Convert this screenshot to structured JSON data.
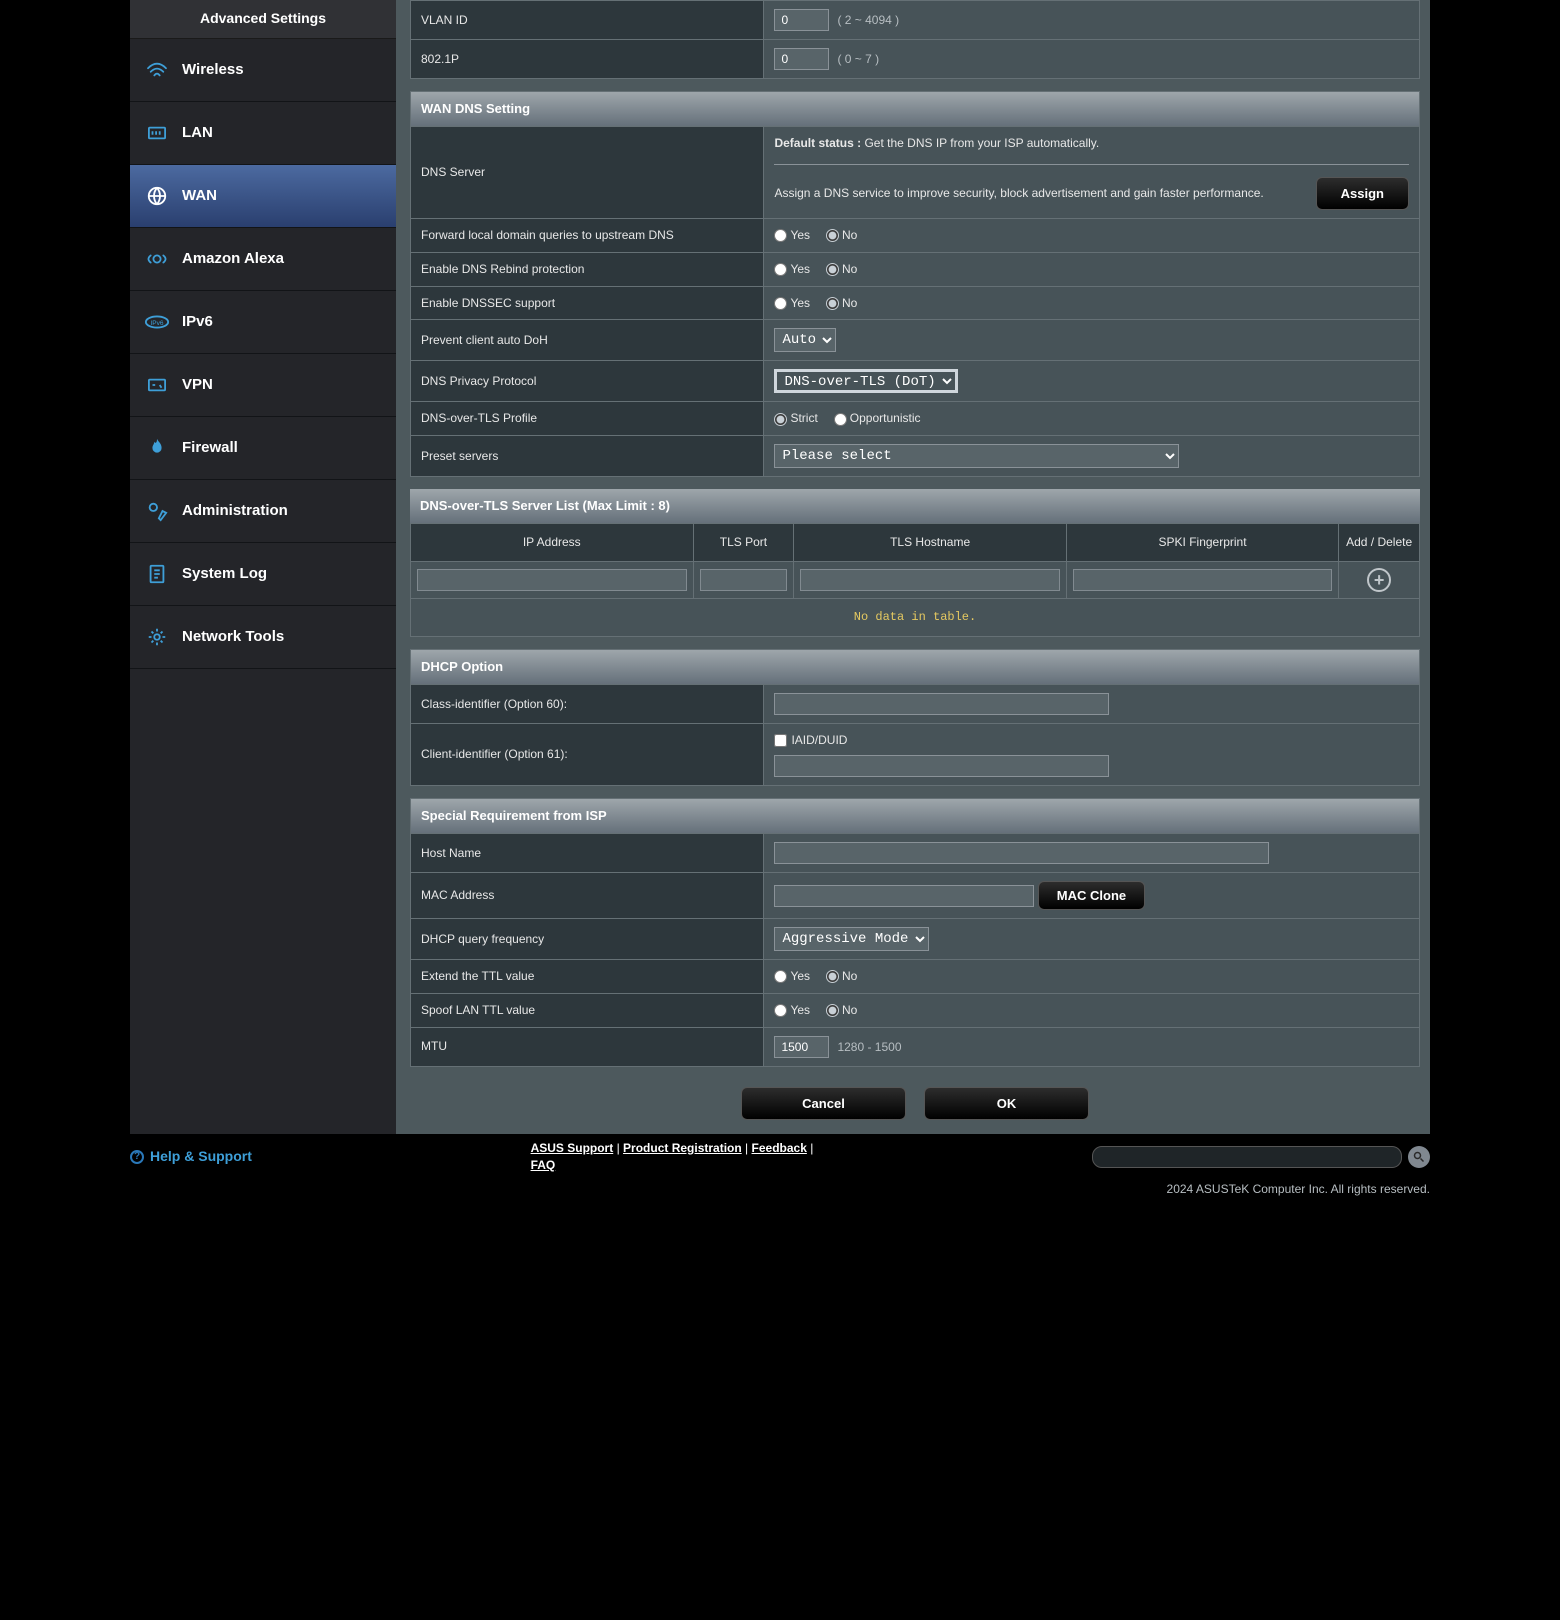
{
  "sidebar": {
    "title": "Advanced Settings",
    "items": [
      {
        "label": "Wireless"
      },
      {
        "label": "LAN"
      },
      {
        "label": "WAN"
      },
      {
        "label": "Amazon Alexa"
      },
      {
        "label": "IPv6"
      },
      {
        "label": "VPN"
      },
      {
        "label": "Firewall"
      },
      {
        "label": "Administration"
      },
      {
        "label": "System Log"
      },
      {
        "label": "Network Tools"
      }
    ]
  },
  "vlan": {
    "id_label": "VLAN ID",
    "id_value": "0",
    "id_hint": "( 2 ~ 4094 )",
    "p_label": "802.1P",
    "p_value": "0",
    "p_hint": "( 0 ~ 7 )"
  },
  "wan_dns": {
    "header": "WAN DNS Setting",
    "server_label": "DNS Server",
    "default_status_label": "Default status :",
    "default_status_text": "Get the DNS IP from your ISP automatically.",
    "assign_text": "Assign a DNS service to improve security, block advertisement and gain faster performance.",
    "assign_btn": "Assign",
    "forward_label": "Forward local domain queries to upstream DNS",
    "rebind_label": "Enable DNS Rebind protection",
    "dnssec_label": "Enable DNSSEC support",
    "doh_label": "Prevent client auto DoH",
    "doh_value": "Auto",
    "privacy_label": "DNS Privacy Protocol",
    "privacy_value": "DNS-over-TLS (DoT)",
    "profile_label": "DNS-over-TLS Profile",
    "strict": "Strict",
    "opp": "Opportunistic",
    "preset_label": "Preset servers",
    "preset_value": "Please select"
  },
  "yes": "Yes",
  "no": "No",
  "dot": {
    "header": "DNS-over-TLS Server List (Max Limit : 8)",
    "cols": {
      "ip": "IP Address",
      "port": "TLS Port",
      "host": "TLS Hostname",
      "spki": "SPKI Fingerprint",
      "action": "Add / Delete"
    },
    "empty": "No data in table."
  },
  "dhcp": {
    "header": "DHCP Option",
    "class_label": "Class-identifier (Option 60):",
    "client_label": "Client-identifier (Option 61):",
    "iaid": "IAID/DUID"
  },
  "isp": {
    "header": "Special Requirement from ISP",
    "host_label": "Host Name",
    "mac_label": "MAC Address",
    "mac_btn": "MAC Clone",
    "freq_label": "DHCP query frequency",
    "freq_value": "Aggressive Mode",
    "ttl_label": "Extend the TTL value",
    "spoof_label": "Spoof LAN TTL value",
    "mtu_label": "MTU",
    "mtu_value": "1500",
    "mtu_hint": "1280 - 1500"
  },
  "buttons": {
    "cancel": "Cancel",
    "ok": "OK"
  },
  "footer": {
    "help": "Help & Support",
    "links": {
      "support": "ASUS Support",
      "reg": "Product Registration",
      "feedback": "Feedback",
      "faq": "FAQ"
    },
    "sep": " | ",
    "copy": "2024 ASUSTeK Computer Inc. All rights reserved."
  }
}
